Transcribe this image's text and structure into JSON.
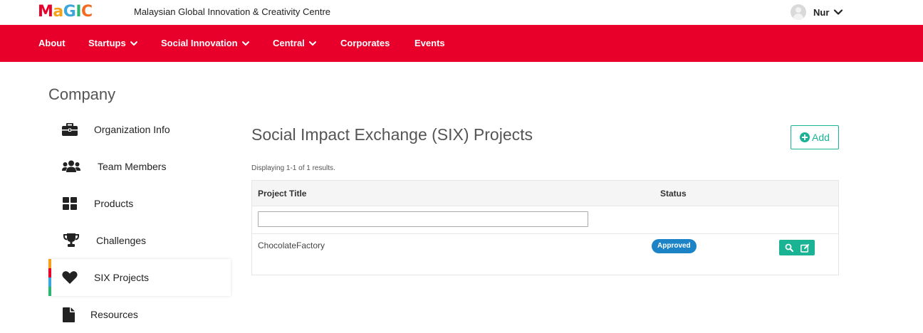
{
  "header": {
    "logo": {
      "letters": [
        {
          "ch": "M",
          "color": "#e8002a"
        },
        {
          "ch": "a",
          "color": "#f6a11a"
        },
        {
          "ch": "G",
          "color": "#3aa6dd"
        },
        {
          "ch": "I",
          "color": "#2bb673"
        },
        {
          "ch": "C",
          "color": "#f26b21"
        }
      ]
    },
    "site_name": "Malaysian Global Innovation & Creativity Centre",
    "user_name": "Nur"
  },
  "nav": {
    "items": [
      {
        "label": "About",
        "dropdown": false
      },
      {
        "label": "Startups",
        "dropdown": true
      },
      {
        "label": "Social Innovation",
        "dropdown": true
      },
      {
        "label": "Central",
        "dropdown": true
      },
      {
        "label": "Corporates",
        "dropdown": false
      },
      {
        "label": "Events",
        "dropdown": false
      }
    ],
    "background": "#e8002a"
  },
  "sidebar": {
    "title": "Company",
    "items": [
      {
        "label": "Organization Info",
        "icon": "briefcase-icon"
      },
      {
        "label": "Team Members",
        "icon": "users-icon"
      },
      {
        "label": "Products",
        "icon": "grid-icon"
      },
      {
        "label": "Challenges",
        "icon": "trophy-icon"
      },
      {
        "label": "SIX Projects",
        "icon": "heart-icon",
        "active": true
      },
      {
        "label": "Resources",
        "icon": "file-icon"
      }
    ],
    "active_bar_colors": [
      "#f6a11a",
      "#e8002a",
      "#3aa6dd",
      "#2bb673"
    ]
  },
  "main": {
    "title": "Social Impact Exchange (SIX) Projects",
    "add_label": "Add",
    "summary": "Displaying 1-1 of 1 results.",
    "table": {
      "columns": [
        "Project Title",
        "Status"
      ],
      "filter_value": "",
      "rows": [
        {
          "title": "ChocolateFactory",
          "status": "Approved"
        }
      ]
    },
    "accent": "#1ab394",
    "status_color": "#1c84c6"
  }
}
